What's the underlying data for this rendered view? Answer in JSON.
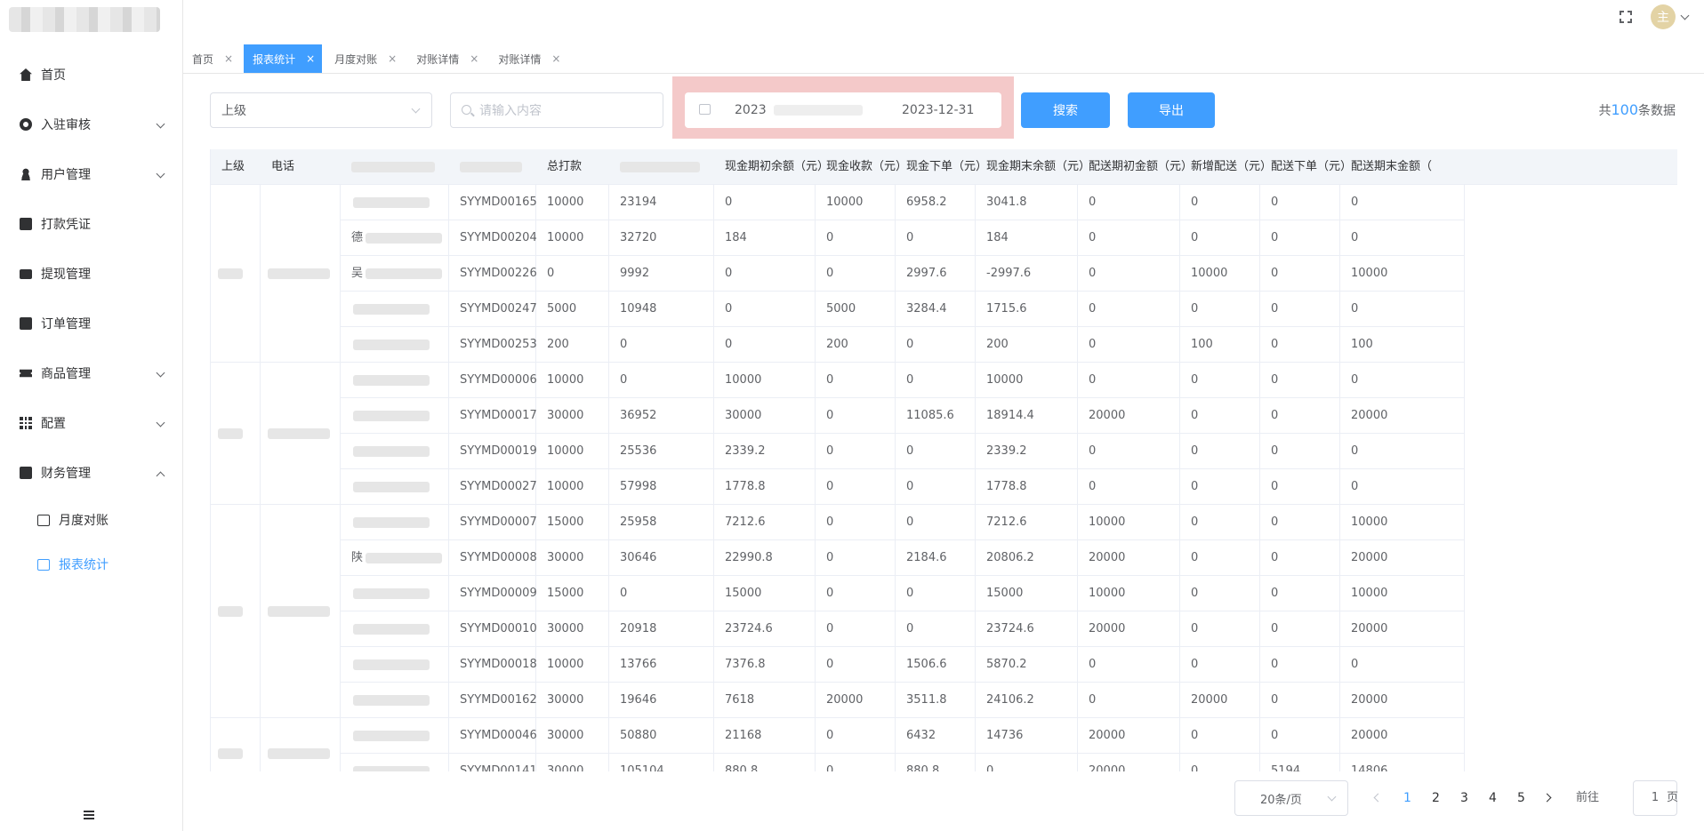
{
  "sidebar": {
    "items": [
      {
        "label": "首页",
        "icon": "home-icon",
        "expandable": false
      },
      {
        "label": "入驻审核",
        "icon": "gear-icon",
        "expandable": true
      },
      {
        "label": "用户管理",
        "icon": "user-icon",
        "expandable": true
      },
      {
        "label": "打款凭证",
        "icon": "document-icon",
        "expandable": false
      },
      {
        "label": "提现管理",
        "icon": "wallet-icon",
        "expandable": false
      },
      {
        "label": "订单管理",
        "icon": "checklist-icon",
        "expandable": false
      },
      {
        "label": "商品管理",
        "icon": "ticket-icon",
        "expandable": true
      },
      {
        "label": "配置",
        "icon": "grid-icon",
        "expandable": true
      },
      {
        "label": "财务管理",
        "icon": "chart-icon",
        "expandable": true,
        "expanded": true
      }
    ],
    "subitems": [
      {
        "label": "月度对账",
        "icon": "calendar-icon",
        "active": false
      },
      {
        "label": "报表统计",
        "icon": "report-icon",
        "active": true
      }
    ]
  },
  "header": {
    "avatar_text": "主"
  },
  "tabs": [
    {
      "label": "首页",
      "active": false
    },
    {
      "label": "报表统计",
      "active": true
    },
    {
      "label": "月度对账",
      "active": false
    },
    {
      "label": "对账详情",
      "active": false
    },
    {
      "label": "对账详情",
      "active": false
    }
  ],
  "tab_close": "×",
  "filters": {
    "select_value": "上级",
    "search_placeholder": "请输入内容",
    "date_start": "2023",
    "date_end": "2023-12-31",
    "search_button": "搜索",
    "export_button": "导出",
    "total_prefix": "共",
    "total_count": "100",
    "total_suffix": "条数据"
  },
  "table": {
    "columns": [
      "上级",
      "电话",
      "",
      "",
      "总打款",
      "",
      "现金期初余额（元）",
      "现金收款（元）",
      "现金下单（元）",
      "现金期末余额（元）",
      "配送期初金额（元）",
      "新增配送（元）",
      "配送下单（元）",
      "配送期末金额（"
    ],
    "rows": [
      {
        "name": "",
        "code": "SYYMD00165",
        "total": "10000",
        "c5": "23194",
        "cashOpen": "0",
        "cashIn": "10000",
        "cashOrder": "6958.2",
        "cashEnd": "3041.8",
        "delOpen": "0",
        "delNew": "0",
        "delOrder": "0",
        "delEnd": "0"
      },
      {
        "name": "德",
        "code": "SYYMD00204",
        "total": "10000",
        "c5": "32720",
        "cashOpen": "184",
        "cashIn": "0",
        "cashOrder": "0",
        "cashEnd": "184",
        "delOpen": "0",
        "delNew": "0",
        "delOrder": "0",
        "delEnd": "0"
      },
      {
        "name": "吴",
        "code": "SYYMD00226",
        "total": "0",
        "c5": "9992",
        "cashOpen": "0",
        "cashIn": "0",
        "cashOrder": "2997.6",
        "cashEnd": "-2997.6",
        "delOpen": "0",
        "delNew": "10000",
        "delOrder": "0",
        "delEnd": "10000"
      },
      {
        "name": "",
        "code": "SYYMD00247",
        "total": "5000",
        "c5": "10948",
        "cashOpen": "0",
        "cashIn": "5000",
        "cashOrder": "3284.4",
        "cashEnd": "1715.6",
        "delOpen": "0",
        "delNew": "0",
        "delOrder": "0",
        "delEnd": "0"
      },
      {
        "name": "",
        "code": "SYYMD00253",
        "total": "200",
        "c5": "0",
        "cashOpen": "0",
        "cashIn": "200",
        "cashOrder": "0",
        "cashEnd": "200",
        "delOpen": "0",
        "delNew": "100",
        "delOrder": "0",
        "delEnd": "100"
      },
      {
        "name": "",
        "code": "SYYMD00006",
        "total": "10000",
        "c5": "0",
        "cashOpen": "10000",
        "cashIn": "0",
        "cashOrder": "0",
        "cashEnd": "10000",
        "delOpen": "0",
        "delNew": "0",
        "delOrder": "0",
        "delEnd": "0"
      },
      {
        "name": "",
        "code": "SYYMD00017",
        "total": "30000",
        "c5": "36952",
        "cashOpen": "30000",
        "cashIn": "0",
        "cashOrder": "11085.6",
        "cashEnd": "18914.4",
        "delOpen": "20000",
        "delNew": "0",
        "delOrder": "0",
        "delEnd": "20000"
      },
      {
        "name": "",
        "code": "SYYMD00019",
        "total": "10000",
        "c5": "25536",
        "cashOpen": "2339.2",
        "cashIn": "0",
        "cashOrder": "0",
        "cashEnd": "2339.2",
        "delOpen": "0",
        "delNew": "0",
        "delOrder": "0",
        "delEnd": "0"
      },
      {
        "name": "",
        "code": "SYYMD00027",
        "total": "10000",
        "c5": "57998",
        "cashOpen": "1778.8",
        "cashIn": "0",
        "cashOrder": "0",
        "cashEnd": "1778.8",
        "delOpen": "0",
        "delNew": "0",
        "delOrder": "0",
        "delEnd": "0"
      },
      {
        "name": "",
        "code": "SYYMD00007",
        "total": "15000",
        "c5": "25958",
        "cashOpen": "7212.6",
        "cashIn": "0",
        "cashOrder": "0",
        "cashEnd": "7212.6",
        "delOpen": "10000",
        "delNew": "0",
        "delOrder": "0",
        "delEnd": "10000"
      },
      {
        "name": "陕",
        "code": "SYYMD00008",
        "total": "30000",
        "c5": "30646",
        "cashOpen": "22990.8",
        "cashIn": "0",
        "cashOrder": "2184.6",
        "cashEnd": "20806.2",
        "delOpen": "20000",
        "delNew": "0",
        "delOrder": "0",
        "delEnd": "20000"
      },
      {
        "name": "",
        "code": "SYYMD00009",
        "total": "15000",
        "c5": "0",
        "cashOpen": "15000",
        "cashIn": "0",
        "cashOrder": "0",
        "cashEnd": "15000",
        "delOpen": "10000",
        "delNew": "0",
        "delOrder": "0",
        "delEnd": "10000"
      },
      {
        "name": "",
        "code": "SYYMD00010",
        "total": "30000",
        "c5": "20918",
        "cashOpen": "23724.6",
        "cashIn": "0",
        "cashOrder": "0",
        "cashEnd": "23724.6",
        "delOpen": "20000",
        "delNew": "0",
        "delOrder": "0",
        "delEnd": "20000"
      },
      {
        "name": "",
        "code": "SYYMD00018",
        "total": "10000",
        "c5": "13766",
        "cashOpen": "7376.8",
        "cashIn": "0",
        "cashOrder": "1506.6",
        "cashEnd": "5870.2",
        "delOpen": "0",
        "delNew": "0",
        "delOrder": "0",
        "delEnd": "0"
      },
      {
        "name": "",
        "code": "SYYMD00162",
        "total": "30000",
        "c5": "19646",
        "cashOpen": "7618",
        "cashIn": "20000",
        "cashOrder": "3511.8",
        "cashEnd": "24106.2",
        "delOpen": "0",
        "delNew": "20000",
        "delOrder": "0",
        "delEnd": "20000"
      },
      {
        "name": "",
        "code": "SYYMD00046",
        "total": "30000",
        "c5": "50880",
        "cashOpen": "21168",
        "cashIn": "0",
        "cashOrder": "6432",
        "cashEnd": "14736",
        "delOpen": "20000",
        "delNew": "0",
        "delOrder": "0",
        "delEnd": "20000"
      },
      {
        "name": "",
        "code": "SYYMD00141",
        "total": "30000",
        "c5": "105104",
        "cashOpen": "880.8",
        "cashIn": "0",
        "cashOrder": "880.8",
        "cashEnd": "0",
        "delOpen": "20000",
        "delNew": "0",
        "delOrder": "5194",
        "delEnd": "14806"
      }
    ]
  },
  "pagination": {
    "page_size": "20条/页",
    "pages": [
      "1",
      "2",
      "3",
      "4",
      "5"
    ],
    "current": "1",
    "goto_label": "前往",
    "goto_value": "1",
    "page_suffix": "页"
  }
}
